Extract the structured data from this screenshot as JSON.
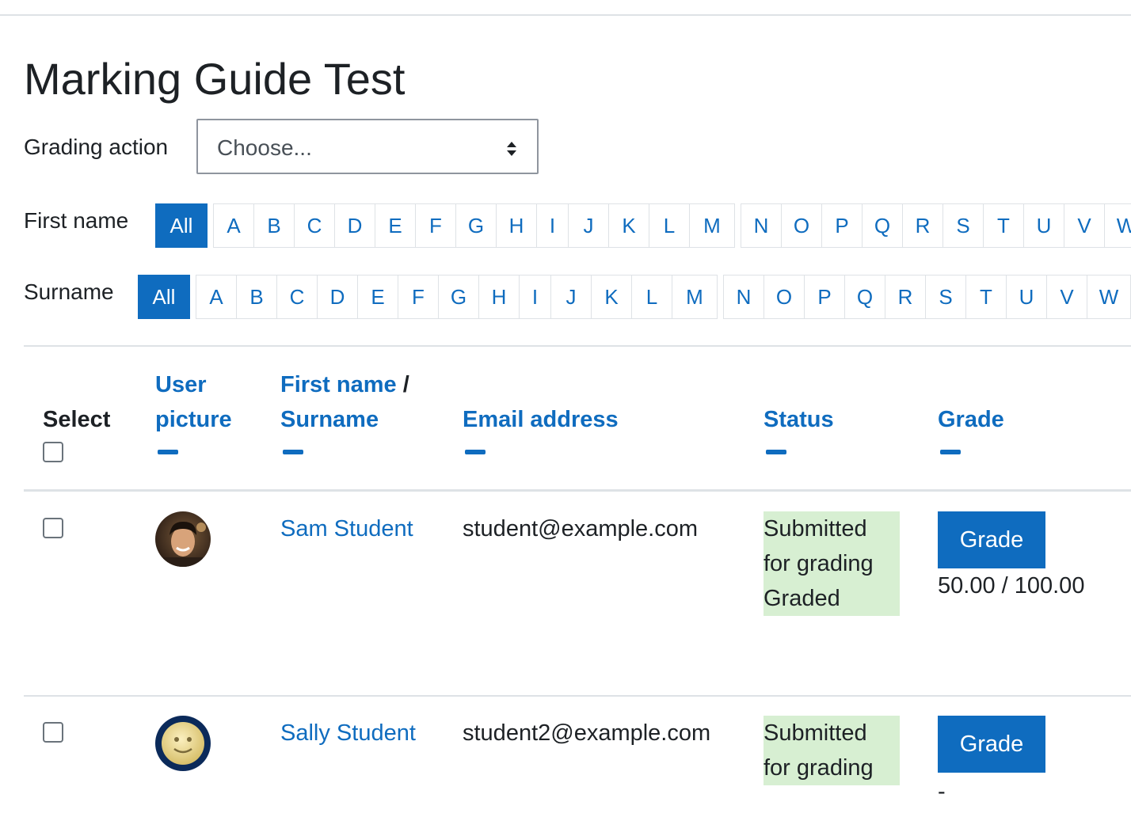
{
  "page": {
    "title": "Marking Guide Test"
  },
  "grading_action": {
    "label": "Grading action",
    "selected": "Choose..."
  },
  "first_name_bar": {
    "label": "First name",
    "all": "All",
    "letters": [
      "A",
      "B",
      "C",
      "D",
      "E",
      "F",
      "G",
      "H",
      "I",
      "J",
      "K",
      "L",
      "M",
      "N",
      "O",
      "P",
      "Q",
      "R",
      "S",
      "T",
      "U",
      "V",
      "W"
    ]
  },
  "surname_bar": {
    "label": "Surname",
    "all": "All",
    "letters": [
      "A",
      "B",
      "C",
      "D",
      "E",
      "F",
      "G",
      "H",
      "I",
      "J",
      "K",
      "L",
      "M",
      "N",
      "O",
      "P",
      "Q",
      "R",
      "S",
      "T",
      "U",
      "V",
      "W"
    ]
  },
  "table": {
    "headers": {
      "select": "Select",
      "user_picture_1": "User",
      "user_picture_2": "picture",
      "first_name": "First name",
      "slash": "/",
      "surname": "Surname",
      "email": "Email address",
      "status": "Status",
      "grade": "Grade"
    },
    "rows": [
      {
        "name": "Sam Student",
        "email": "student@example.com",
        "status": [
          "Submitted",
          "for grading",
          "Graded"
        ],
        "grade_button": "Grade",
        "grade": "50.00 / 100.00"
      },
      {
        "name": "Sally Student",
        "email": "student2@example.com",
        "status": [
          "Submitted",
          "for grading"
        ],
        "grade_button": "Grade",
        "grade": "-"
      }
    ]
  },
  "colors": {
    "accent": "#0f6cbf",
    "status_bg": "#d7efd2",
    "text": "#1d2125"
  }
}
